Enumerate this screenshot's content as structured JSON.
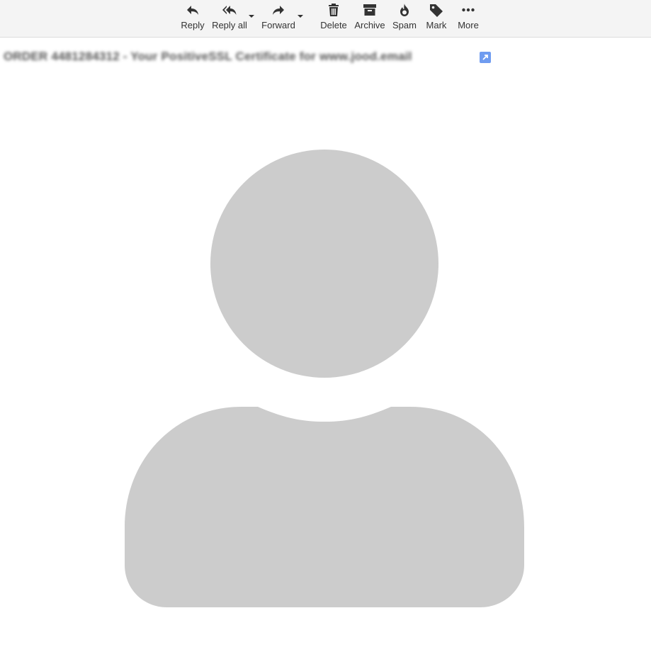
{
  "toolbar": {
    "buttons": [
      {
        "label": "Reply",
        "icon": "reply-icon"
      },
      {
        "label": "Reply all",
        "icon": "reply-all-icon"
      },
      {
        "label": "Forward",
        "icon": "forward-icon"
      },
      {
        "label": "Delete",
        "icon": "trash-icon"
      },
      {
        "label": "Archive",
        "icon": "archive-icon"
      },
      {
        "label": "Spam",
        "icon": "spam-icon"
      },
      {
        "label": "Mark",
        "icon": "tag-icon"
      },
      {
        "label": "More",
        "icon": "more-icon"
      }
    ]
  },
  "message": {
    "subject": "ORDER 4481284312 - Your PositiveSSL Certificate for www.jood.email",
    "open_icon": "open-in-new-window-icon"
  },
  "avatar": {
    "icon": "default-user-avatar-icon",
    "color": "#cccccc"
  },
  "colors": {
    "toolbar_bg": "#f4f4f4",
    "icon": "#333333",
    "accent": "#6f9cf0"
  }
}
